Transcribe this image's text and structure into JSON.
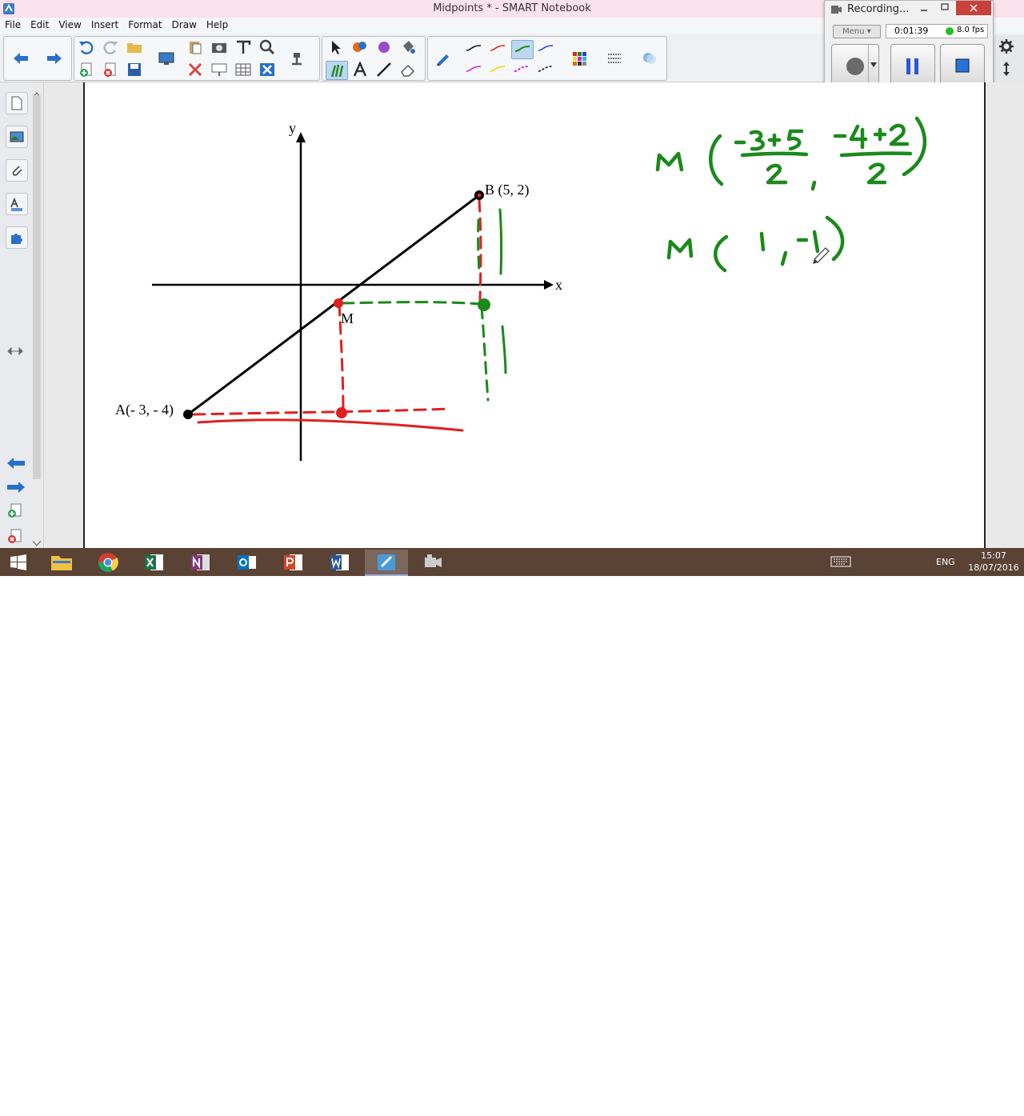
{
  "window": {
    "title": "Midpoints * - SMART Notebook"
  },
  "menu": [
    "File",
    "Edit",
    "View",
    "Insert",
    "Format",
    "Draw",
    "Help"
  ],
  "recorder": {
    "title": "Recording...",
    "menu_label": "Menu",
    "elapsed": "0:01:39",
    "fps": "8.0 fps"
  },
  "diagram": {
    "x_label": "x",
    "y_label": "y",
    "point_a": "A(- 3, - 4)",
    "point_b": "B (5, 2)",
    "point_m": "M"
  },
  "handwriting": {
    "line1": "M ( (-3+5)/2 , (-4+2)/2 )",
    "line2": "M ( 1 , -1 )"
  },
  "taskbar": {
    "language": "ENG",
    "time": "15:07",
    "date": "18/07/2016"
  },
  "icons": [
    "windows-start",
    "file-explorer",
    "chrome",
    "excel",
    "onenote",
    "outlook",
    "powerpoint",
    "word",
    "smart-notebook",
    "recorder"
  ],
  "colors": {
    "ink_green": "#1a8a1a",
    "ink_red": "#e02020",
    "axis_black": "#000000",
    "title_bar": "#fbe2ec",
    "taskbar": "#5a4234"
  }
}
